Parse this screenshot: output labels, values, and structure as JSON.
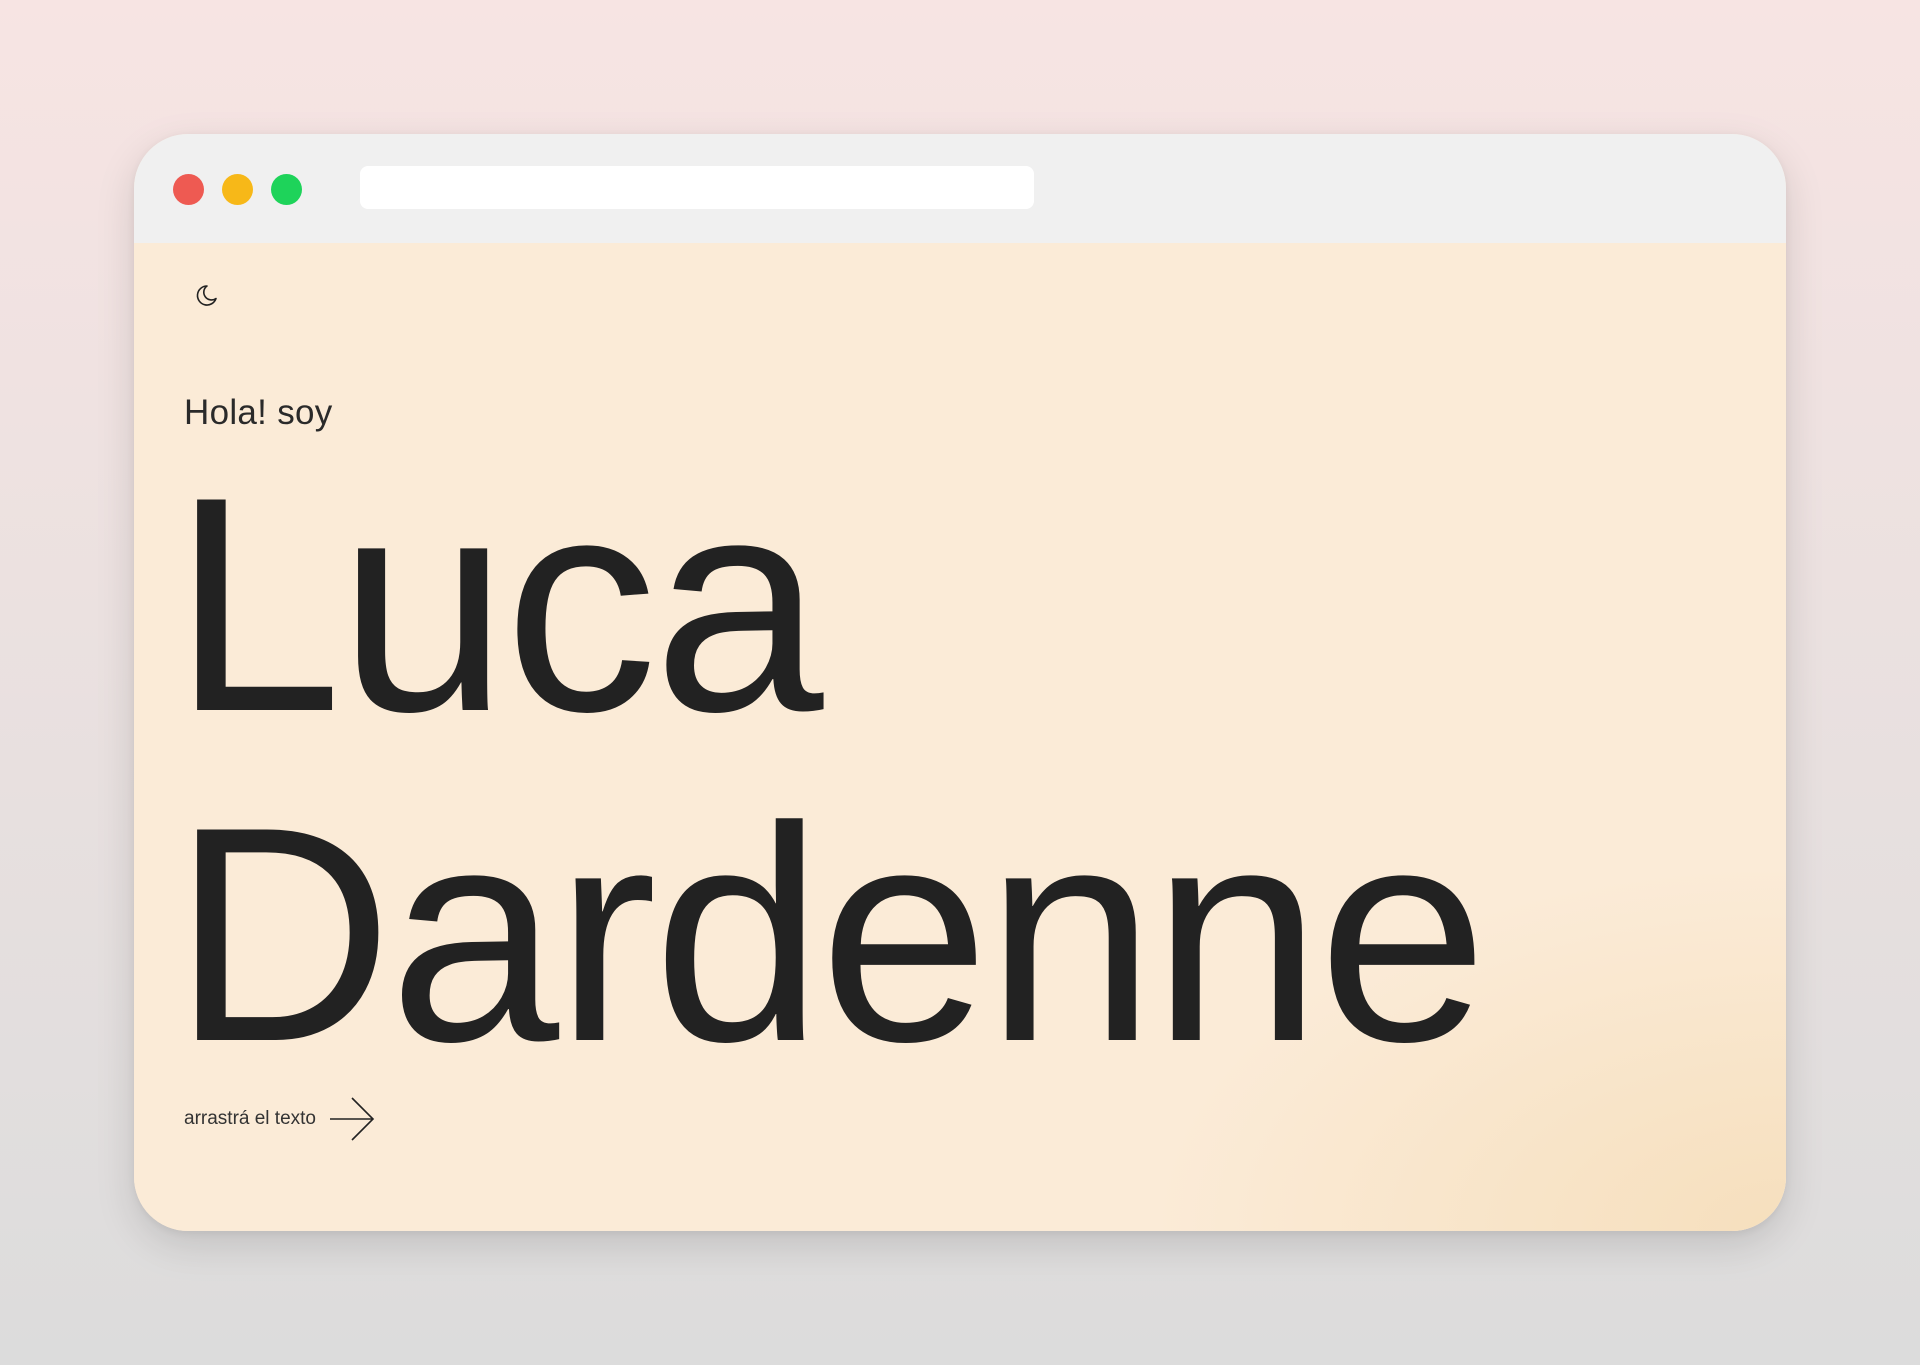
{
  "browser": {
    "url": "",
    "traffic_lights": {
      "close_color": "#ee5a52",
      "minimize_color": "#f7b818",
      "maximize_color": "#1ed35a"
    }
  },
  "page": {
    "theme_toggle_icon": "moon-icon",
    "greeting": "Hola! soy",
    "first_name": "Luca",
    "last_name": "Dardenne",
    "hint": "arrastrá el texto",
    "hint_icon": "arrow-right-icon",
    "background_color": "#fbebd7",
    "text_color": "#222222"
  }
}
